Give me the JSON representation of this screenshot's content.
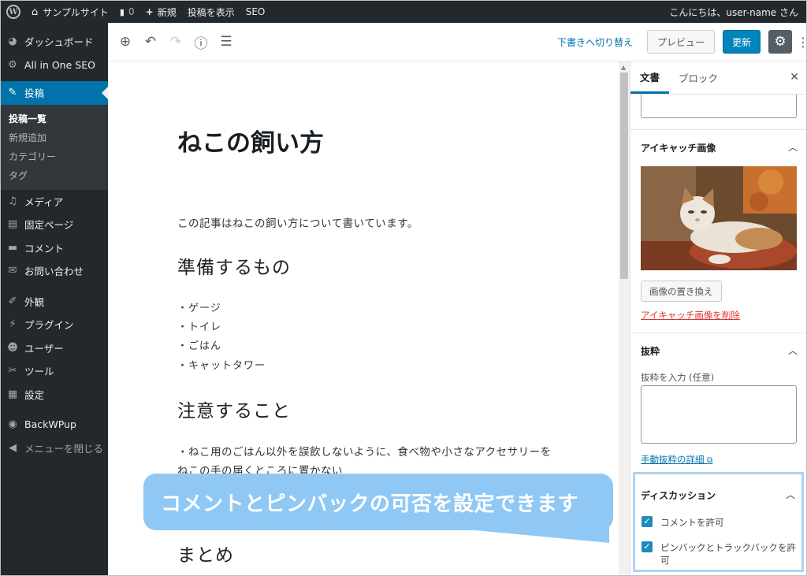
{
  "adminbar": {
    "site_name": "サンプルサイト",
    "comments_count": "0",
    "new_label": "新規",
    "view_post": "投稿を表示",
    "seo": "SEO",
    "greeting": "こんにちは、user-name さん"
  },
  "sidebar": {
    "items": [
      {
        "label": "ダッシュボード",
        "icon": "dashboard-icon"
      },
      {
        "label": "All in One SEO",
        "icon": "seo-gear-icon"
      },
      {
        "label": "投稿",
        "icon": "pin-icon"
      },
      {
        "label": "メディア",
        "icon": "media-icon"
      },
      {
        "label": "固定ページ",
        "icon": "page-icon"
      },
      {
        "label": "コメント",
        "icon": "comment-icon"
      },
      {
        "label": "お問い合わせ",
        "icon": "mail-icon"
      },
      {
        "label": "外観",
        "icon": "appearance-icon"
      },
      {
        "label": "プラグイン",
        "icon": "plugin-icon"
      },
      {
        "label": "ユーザー",
        "icon": "user-icon"
      },
      {
        "label": "ツール",
        "icon": "wrench-icon"
      },
      {
        "label": "設定",
        "icon": "settings-icon"
      },
      {
        "label": "BackWPup",
        "icon": "backwpup-icon"
      },
      {
        "label": "メニューを閉じる",
        "icon": "collapse-icon"
      }
    ],
    "submenu": [
      "投稿一覧",
      "新規追加",
      "カテゴリー",
      "タグ"
    ]
  },
  "toolbar": {
    "switch_draft": "下書きへ切り替え",
    "preview": "プレビュー",
    "update": "更新"
  },
  "post": {
    "title": "ねこの飼い方",
    "intro": "この記事はねこの飼い方について書いています。",
    "heading1": "準備するもの",
    "list": [
      "・ゲージ",
      "・トイレ",
      "・ごはん",
      "・キャットタワー"
    ],
    "heading2": "注意すること",
    "caution_line1": "・ねこ用のごはん以外を誤飲しないように、食べ物や小さなアクセサリーを",
    "caution_line2": "ねこの手の届くところに置かない",
    "heading3": "まとめ"
  },
  "panel": {
    "tab_document": "文書",
    "tab_block": "ブロック",
    "featured_image_title": "アイキャッチ画像",
    "replace_image": "画像の置き換え",
    "remove_image": "アイキャッチ画像を削除",
    "excerpt_title": "抜粋",
    "excerpt_label": "抜粋を入力 (任意)",
    "excerpt_link": "手動抜粋の詳細",
    "discussion_title": "ディスカッション",
    "allow_comments": "コメントを許可",
    "allow_pingbacks": "ピンバックとトラックバックを許可"
  },
  "callout": {
    "text": "コメントとピンバックの可否を設定できます",
    "color": "#8fc8f5"
  },
  "colors": {
    "admin_bg": "#23282d",
    "active_menu": "#0073aa",
    "update_button": "#0085ba",
    "remove_link": "#dc3232"
  }
}
